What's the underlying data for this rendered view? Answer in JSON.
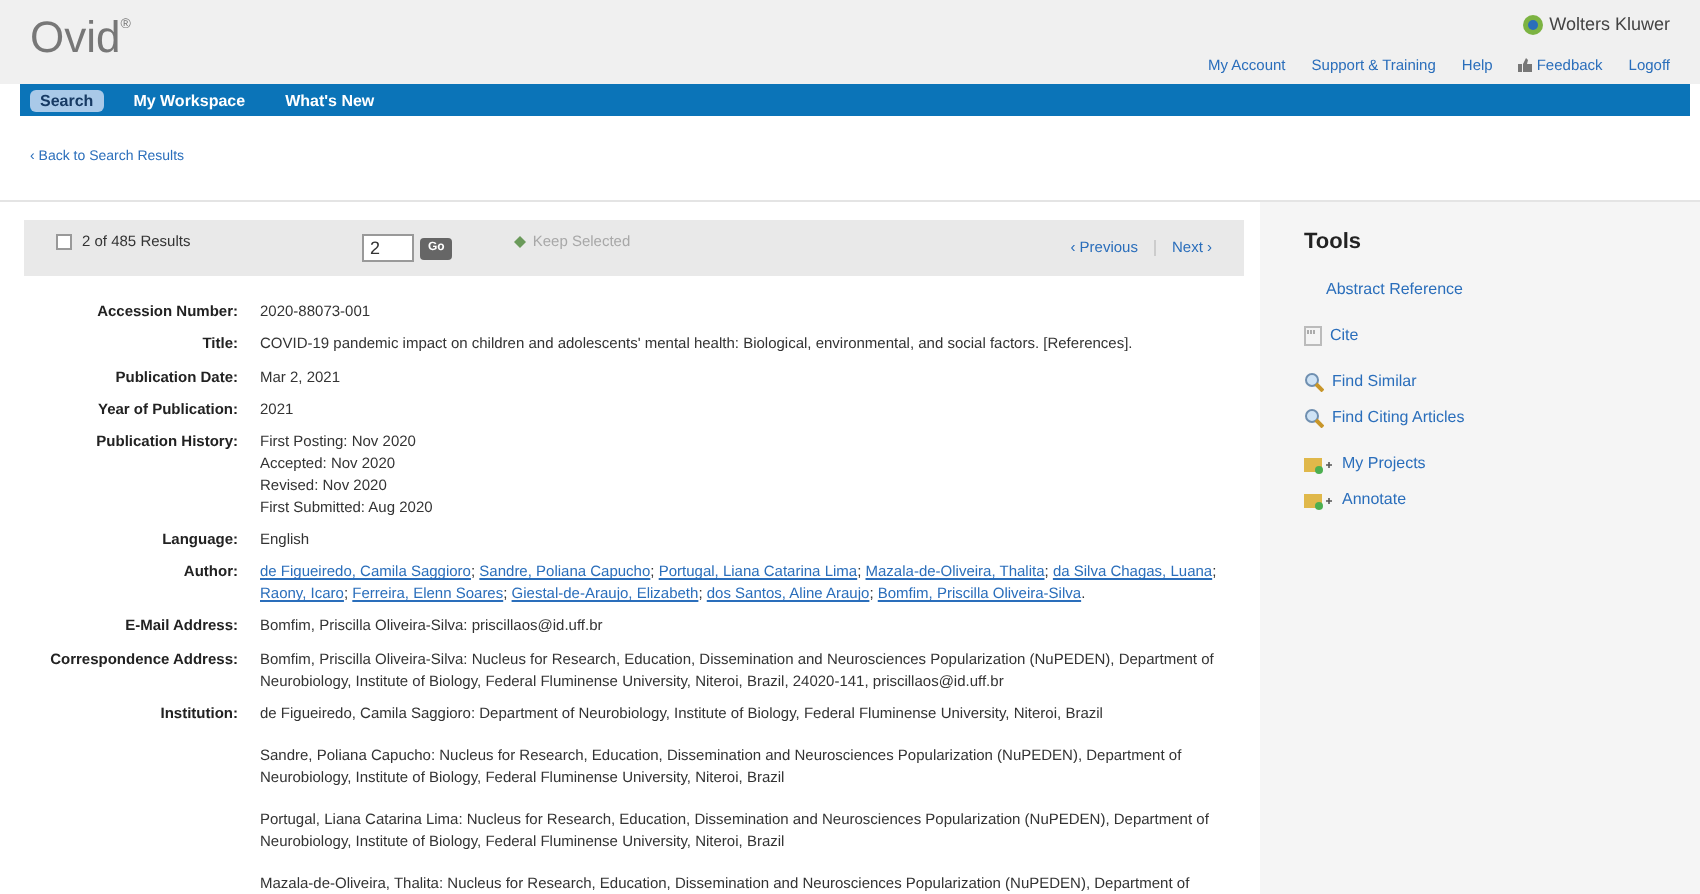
{
  "brand": {
    "logo": "Ovid",
    "logo_mark": "®",
    "publisher": "Wolters Kluwer"
  },
  "account_links": [
    {
      "label": "My Account",
      "kind": "plain"
    },
    {
      "label": "Support & Training",
      "kind": "plain"
    },
    {
      "label": "Help",
      "kind": "plain"
    },
    {
      "label": "Feedback",
      "kind": "feedback"
    },
    {
      "label": "Logoff",
      "kind": "plain"
    }
  ],
  "nav_tabs": [
    {
      "label": "Search",
      "selected": true
    },
    {
      "label": "My Workspace",
      "selected": false
    },
    {
      "label": "What's New",
      "selected": false
    }
  ],
  "back_link": "‹ Back to Search Results",
  "results_bar": {
    "checked": false,
    "count": "2 of 485 Results",
    "page_value": "2",
    "go": "Go",
    "keep_selected": {
      "label": "Keep Selected",
      "disabled": true
    },
    "previous": "‹ Previous",
    "next": "Next ›"
  },
  "record": [
    {
      "label": "Accession Number:",
      "kind": "text",
      "value": "2020-88073-001"
    },
    {
      "label": "Title:",
      "kind": "text",
      "value": "COVID-19 pandemic impact on children and adolescents' mental health: Biological, environmental, and social factors. [References]."
    },
    {
      "label": "Publication Date:",
      "kind": "text",
      "value": "Mar 2, 2021"
    },
    {
      "label": "Year of Publication:",
      "kind": "text",
      "value": "2021"
    },
    {
      "label": "Publication History:",
      "kind": "lines",
      "lines": [
        "First Posting: Nov 2020",
        "Accepted: Nov 2020",
        "Revised: Nov 2020",
        "First Submitted: Aug 2020"
      ]
    },
    {
      "label": "Language:",
      "kind": "text",
      "value": "English"
    },
    {
      "label": "Author:",
      "kind": "links",
      "links": [
        {
          "text": "de Figueiredo, Camila Saggioro",
          "punct": ";"
        },
        {
          "text": "Sandre, Poliana Capucho",
          "punct": ";"
        },
        {
          "text": "Portugal, Liana Catarina Lima",
          "punct": ";"
        },
        {
          "text": "Mazala-de-Oliveira, Thalita",
          "punct": ";"
        },
        {
          "text": "da Silva Chagas, Luana",
          "punct": ";"
        },
        {
          "text": "Raony, Icaro",
          "punct": ";"
        },
        {
          "text": "Ferreira, Elenn Soares",
          "punct": ";"
        },
        {
          "text": "Giestal-de-Araujo, Elizabeth",
          "punct": ";"
        },
        {
          "text": "dos Santos, Aline Araujo",
          "punct": ";"
        },
        {
          "text": "Bomfim, Priscilla Oliveira-Silva",
          "punct": "."
        }
      ]
    },
    {
      "label": "E-Mail Address:",
      "kind": "text",
      "value": "Bomfim, Priscilla Oliveira-Silva: priscillaos@id.uff.br"
    },
    {
      "label": "Correspondence Address:",
      "kind": "text",
      "value": "Bomfim, Priscilla Oliveira-Silva: Nucleus for Research, Education, Dissemination and Neurosciences Popularization (NuPEDEN), Department of Neurobiology, Institute of Biology, Federal Fluminense University, Niteroi, Brazil, 24020-141, priscillaos@id.uff.br"
    },
    {
      "label": "Institution:",
      "kind": "paragraphs",
      "paragraphs": [
        "de Figueiredo, Camila Saggioro: Department of Neurobiology, Institute of Biology, Federal Fluminense University, Niteroi, Brazil",
        "Sandre, Poliana Capucho: Nucleus for Research, Education, Dissemination and Neurosciences Popularization (NuPEDEN), Department of Neurobiology, Institute of Biology, Federal Fluminense University, Niteroi, Brazil",
        "Portugal, Liana Catarina Lima: Nucleus for Research, Education, Dissemination and Neurosciences Popularization (NuPEDEN), Department of Neurobiology, Institute of Biology, Federal Fluminense University, Niteroi, Brazil",
        "Mazala-de-Oliveira, Thalita: Nucleus for Research, Education, Dissemination and Neurosciences Popularization (NuPEDEN), Department of"
      ]
    }
  ],
  "tools": {
    "title": "Tools",
    "groups": [
      [
        {
          "label": "Abstract Reference",
          "kind": "plain"
        }
      ],
      [
        {
          "label": "Cite",
          "kind": "cite"
        }
      ],
      [
        {
          "label": "Find Similar",
          "kind": "search"
        },
        {
          "label": "Find Citing Articles",
          "kind": "search"
        }
      ],
      [
        {
          "label": "My Projects",
          "kind": "add"
        },
        {
          "label": "Annotate",
          "kind": "add"
        }
      ]
    ]
  }
}
